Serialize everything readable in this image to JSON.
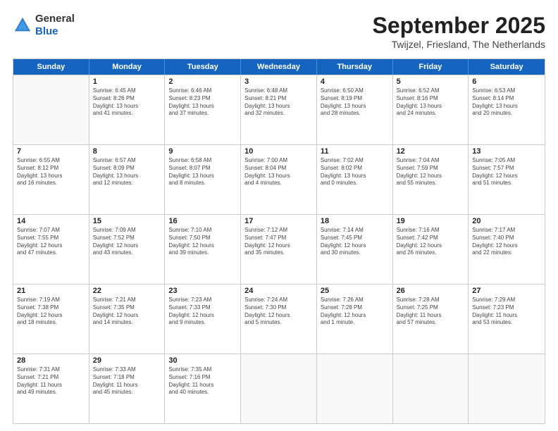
{
  "header": {
    "logo": {
      "general": "General",
      "blue": "Blue"
    },
    "title": "September 2025",
    "location": "Twijzel, Friesland, The Netherlands"
  },
  "days_of_week": [
    "Sunday",
    "Monday",
    "Tuesday",
    "Wednesday",
    "Thursday",
    "Friday",
    "Saturday"
  ],
  "weeks": [
    [
      {
        "day": "",
        "lines": []
      },
      {
        "day": "1",
        "lines": [
          "Sunrise: 6:45 AM",
          "Sunset: 8:26 PM",
          "Daylight: 13 hours",
          "and 41 minutes."
        ]
      },
      {
        "day": "2",
        "lines": [
          "Sunrise: 6:46 AM",
          "Sunset: 8:23 PM",
          "Daylight: 13 hours",
          "and 37 minutes."
        ]
      },
      {
        "day": "3",
        "lines": [
          "Sunrise: 6:48 AM",
          "Sunset: 8:21 PM",
          "Daylight: 13 hours",
          "and 32 minutes."
        ]
      },
      {
        "day": "4",
        "lines": [
          "Sunrise: 6:50 AM",
          "Sunset: 8:19 PM",
          "Daylight: 13 hours",
          "and 28 minutes."
        ]
      },
      {
        "day": "5",
        "lines": [
          "Sunrise: 6:52 AM",
          "Sunset: 8:16 PM",
          "Daylight: 13 hours",
          "and 24 minutes."
        ]
      },
      {
        "day": "6",
        "lines": [
          "Sunrise: 6:53 AM",
          "Sunset: 8:14 PM",
          "Daylight: 13 hours",
          "and 20 minutes."
        ]
      }
    ],
    [
      {
        "day": "7",
        "lines": [
          "Sunrise: 6:55 AM",
          "Sunset: 8:12 PM",
          "Daylight: 13 hours",
          "and 16 minutes."
        ]
      },
      {
        "day": "8",
        "lines": [
          "Sunrise: 6:57 AM",
          "Sunset: 8:09 PM",
          "Daylight: 13 hours",
          "and 12 minutes."
        ]
      },
      {
        "day": "9",
        "lines": [
          "Sunrise: 6:58 AM",
          "Sunset: 8:07 PM",
          "Daylight: 13 hours",
          "and 8 minutes."
        ]
      },
      {
        "day": "10",
        "lines": [
          "Sunrise: 7:00 AM",
          "Sunset: 8:04 PM",
          "Daylight: 13 hours",
          "and 4 minutes."
        ]
      },
      {
        "day": "11",
        "lines": [
          "Sunrise: 7:02 AM",
          "Sunset: 8:02 PM",
          "Daylight: 13 hours",
          "and 0 minutes."
        ]
      },
      {
        "day": "12",
        "lines": [
          "Sunrise: 7:04 AM",
          "Sunset: 7:59 PM",
          "Daylight: 12 hours",
          "and 55 minutes."
        ]
      },
      {
        "day": "13",
        "lines": [
          "Sunrise: 7:05 AM",
          "Sunset: 7:57 PM",
          "Daylight: 12 hours",
          "and 51 minutes."
        ]
      }
    ],
    [
      {
        "day": "14",
        "lines": [
          "Sunrise: 7:07 AM",
          "Sunset: 7:55 PM",
          "Daylight: 12 hours",
          "and 47 minutes."
        ]
      },
      {
        "day": "15",
        "lines": [
          "Sunrise: 7:09 AM",
          "Sunset: 7:52 PM",
          "Daylight: 12 hours",
          "and 43 minutes."
        ]
      },
      {
        "day": "16",
        "lines": [
          "Sunrise: 7:10 AM",
          "Sunset: 7:50 PM",
          "Daylight: 12 hours",
          "and 39 minutes."
        ]
      },
      {
        "day": "17",
        "lines": [
          "Sunrise: 7:12 AM",
          "Sunset: 7:47 PM",
          "Daylight: 12 hours",
          "and 35 minutes."
        ]
      },
      {
        "day": "18",
        "lines": [
          "Sunrise: 7:14 AM",
          "Sunset: 7:45 PM",
          "Daylight: 12 hours",
          "and 30 minutes."
        ]
      },
      {
        "day": "19",
        "lines": [
          "Sunrise: 7:16 AM",
          "Sunset: 7:42 PM",
          "Daylight: 12 hours",
          "and 26 minutes."
        ]
      },
      {
        "day": "20",
        "lines": [
          "Sunrise: 7:17 AM",
          "Sunset: 7:40 PM",
          "Daylight: 12 hours",
          "and 22 minutes."
        ]
      }
    ],
    [
      {
        "day": "21",
        "lines": [
          "Sunrise: 7:19 AM",
          "Sunset: 7:38 PM",
          "Daylight: 12 hours",
          "and 18 minutes."
        ]
      },
      {
        "day": "22",
        "lines": [
          "Sunrise: 7:21 AM",
          "Sunset: 7:35 PM",
          "Daylight: 12 hours",
          "and 14 minutes."
        ]
      },
      {
        "day": "23",
        "lines": [
          "Sunrise: 7:23 AM",
          "Sunset: 7:33 PM",
          "Daylight: 12 hours",
          "and 9 minutes."
        ]
      },
      {
        "day": "24",
        "lines": [
          "Sunrise: 7:24 AM",
          "Sunset: 7:30 PM",
          "Daylight: 12 hours",
          "and 5 minutes."
        ]
      },
      {
        "day": "25",
        "lines": [
          "Sunrise: 7:26 AM",
          "Sunset: 7:28 PM",
          "Daylight: 12 hours",
          "and 1 minute."
        ]
      },
      {
        "day": "26",
        "lines": [
          "Sunrise: 7:28 AM",
          "Sunset: 7:25 PM",
          "Daylight: 11 hours",
          "and 57 minutes."
        ]
      },
      {
        "day": "27",
        "lines": [
          "Sunrise: 7:29 AM",
          "Sunset: 7:23 PM",
          "Daylight: 11 hours",
          "and 53 minutes."
        ]
      }
    ],
    [
      {
        "day": "28",
        "lines": [
          "Sunrise: 7:31 AM",
          "Sunset: 7:21 PM",
          "Daylight: 11 hours",
          "and 49 minutes."
        ]
      },
      {
        "day": "29",
        "lines": [
          "Sunrise: 7:33 AM",
          "Sunset: 7:18 PM",
          "Daylight: 11 hours",
          "and 45 minutes."
        ]
      },
      {
        "day": "30",
        "lines": [
          "Sunrise: 7:35 AM",
          "Sunset: 7:16 PM",
          "Daylight: 11 hours",
          "and 40 minutes."
        ]
      },
      {
        "day": "",
        "lines": []
      },
      {
        "day": "",
        "lines": []
      },
      {
        "day": "",
        "lines": []
      },
      {
        "day": "",
        "lines": []
      }
    ]
  ]
}
